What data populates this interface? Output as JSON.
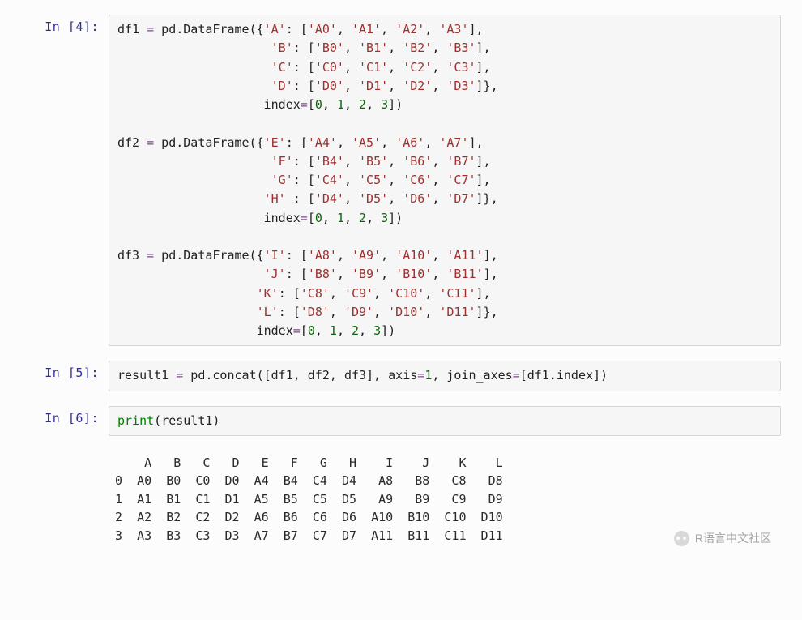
{
  "cells": [
    {
      "prompt": "In  [4]:",
      "type": "code",
      "tokens": [
        [
          "nm",
          "df1 "
        ],
        [
          "op",
          "="
        ],
        [
          "nm",
          " pd"
        ],
        [
          "p",
          "."
        ],
        [
          "nm",
          "DataFrame"
        ],
        [
          "p",
          "({"
        ],
        [
          "str",
          "'A'"
        ],
        [
          "p",
          ": ["
        ],
        [
          "str",
          "'A0'"
        ],
        [
          "p",
          ", "
        ],
        [
          "str",
          "'A1'"
        ],
        [
          "p",
          ", "
        ],
        [
          "str",
          "'A2'"
        ],
        [
          "p",
          ", "
        ],
        [
          "str",
          "'A3'"
        ],
        [
          "p",
          "],\n"
        ],
        [
          "p",
          "                     "
        ],
        [
          "str",
          "'B'"
        ],
        [
          "p",
          ": ["
        ],
        [
          "str",
          "'B0'"
        ],
        [
          "p",
          ", "
        ],
        [
          "str",
          "'B1'"
        ],
        [
          "p",
          ", "
        ],
        [
          "str",
          "'B2'"
        ],
        [
          "p",
          ", "
        ],
        [
          "str",
          "'B3'"
        ],
        [
          "p",
          "],\n"
        ],
        [
          "p",
          "                     "
        ],
        [
          "str",
          "'C'"
        ],
        [
          "p",
          ": ["
        ],
        [
          "str",
          "'C0'"
        ],
        [
          "p",
          ", "
        ],
        [
          "str",
          "'C1'"
        ],
        [
          "p",
          ", "
        ],
        [
          "str",
          "'C2'"
        ],
        [
          "p",
          ", "
        ],
        [
          "str",
          "'C3'"
        ],
        [
          "p",
          "],\n"
        ],
        [
          "p",
          "                     "
        ],
        [
          "str",
          "'D'"
        ],
        [
          "p",
          ": ["
        ],
        [
          "str",
          "'D0'"
        ],
        [
          "p",
          ", "
        ],
        [
          "str",
          "'D1'"
        ],
        [
          "p",
          ", "
        ],
        [
          "str",
          "'D2'"
        ],
        [
          "p",
          ", "
        ],
        [
          "str",
          "'D3'"
        ],
        [
          "p",
          "]},\n"
        ],
        [
          "p",
          "                    index"
        ],
        [
          "op",
          "="
        ],
        [
          "p",
          "["
        ],
        [
          "num",
          "0"
        ],
        [
          "p",
          ", "
        ],
        [
          "num",
          "1"
        ],
        [
          "p",
          ", "
        ],
        [
          "num",
          "2"
        ],
        [
          "p",
          ", "
        ],
        [
          "num",
          "3"
        ],
        [
          "p",
          "])\n"
        ],
        [
          "p",
          "\n"
        ],
        [
          "nm",
          "df2 "
        ],
        [
          "op",
          "="
        ],
        [
          "nm",
          " pd"
        ],
        [
          "p",
          "."
        ],
        [
          "nm",
          "DataFrame"
        ],
        [
          "p",
          "({"
        ],
        [
          "str",
          "'E'"
        ],
        [
          "p",
          ": ["
        ],
        [
          "str",
          "'A4'"
        ],
        [
          "p",
          ", "
        ],
        [
          "str",
          "'A5'"
        ],
        [
          "p",
          ", "
        ],
        [
          "str",
          "'A6'"
        ],
        [
          "p",
          ", "
        ],
        [
          "str",
          "'A7'"
        ],
        [
          "p",
          "],\n"
        ],
        [
          "p",
          "                     "
        ],
        [
          "str",
          "'F'"
        ],
        [
          "p",
          ": ["
        ],
        [
          "str",
          "'B4'"
        ],
        [
          "p",
          ", "
        ],
        [
          "str",
          "'B5'"
        ],
        [
          "p",
          ", "
        ],
        [
          "str",
          "'B6'"
        ],
        [
          "p",
          ", "
        ],
        [
          "str",
          "'B7'"
        ],
        [
          "p",
          "],\n"
        ],
        [
          "p",
          "                     "
        ],
        [
          "str",
          "'G'"
        ],
        [
          "p",
          ": ["
        ],
        [
          "str",
          "'C4'"
        ],
        [
          "p",
          ", "
        ],
        [
          "str",
          "'C5'"
        ],
        [
          "p",
          ", "
        ],
        [
          "str",
          "'C6'"
        ],
        [
          "p",
          ", "
        ],
        [
          "str",
          "'C7'"
        ],
        [
          "p",
          "],\n"
        ],
        [
          "p",
          "                    "
        ],
        [
          "str",
          "'H'"
        ],
        [
          "p",
          " : ["
        ],
        [
          "str",
          "'D4'"
        ],
        [
          "p",
          ", "
        ],
        [
          "str",
          "'D5'"
        ],
        [
          "p",
          ", "
        ],
        [
          "str",
          "'D6'"
        ],
        [
          "p",
          ", "
        ],
        [
          "str",
          "'D7'"
        ],
        [
          "p",
          "]},\n"
        ],
        [
          "p",
          "                    index"
        ],
        [
          "op",
          "="
        ],
        [
          "p",
          "["
        ],
        [
          "num",
          "0"
        ],
        [
          "p",
          ", "
        ],
        [
          "num",
          "1"
        ],
        [
          "p",
          ", "
        ],
        [
          "num",
          "2"
        ],
        [
          "p",
          ", "
        ],
        [
          "num",
          "3"
        ],
        [
          "p",
          "])\n"
        ],
        [
          "p",
          "\n"
        ],
        [
          "nm",
          "df3 "
        ],
        [
          "op",
          "="
        ],
        [
          "nm",
          " pd"
        ],
        [
          "p",
          "."
        ],
        [
          "nm",
          "DataFrame"
        ],
        [
          "p",
          "({"
        ],
        [
          "str",
          "'I'"
        ],
        [
          "p",
          ": ["
        ],
        [
          "str",
          "'A8'"
        ],
        [
          "p",
          ", "
        ],
        [
          "str",
          "'A9'"
        ],
        [
          "p",
          ", "
        ],
        [
          "str",
          "'A10'"
        ],
        [
          "p",
          ", "
        ],
        [
          "str",
          "'A11'"
        ],
        [
          "p",
          "],\n"
        ],
        [
          "p",
          "                    "
        ],
        [
          "str",
          "'J'"
        ],
        [
          "p",
          ": ["
        ],
        [
          "str",
          "'B8'"
        ],
        [
          "p",
          ", "
        ],
        [
          "str",
          "'B9'"
        ],
        [
          "p",
          ", "
        ],
        [
          "str",
          "'B10'"
        ],
        [
          "p",
          ", "
        ],
        [
          "str",
          "'B11'"
        ],
        [
          "p",
          "],\n"
        ],
        [
          "p",
          "                   "
        ],
        [
          "str",
          "'K'"
        ],
        [
          "p",
          ": ["
        ],
        [
          "str",
          "'C8'"
        ],
        [
          "p",
          ", "
        ],
        [
          "str",
          "'C9'"
        ],
        [
          "p",
          ", "
        ],
        [
          "str",
          "'C10'"
        ],
        [
          "p",
          ", "
        ],
        [
          "str",
          "'C11'"
        ],
        [
          "p",
          "],\n"
        ],
        [
          "p",
          "                   "
        ],
        [
          "str",
          "'L'"
        ],
        [
          "p",
          ": ["
        ],
        [
          "str",
          "'D8'"
        ],
        [
          "p",
          ", "
        ],
        [
          "str",
          "'D9'"
        ],
        [
          "p",
          ", "
        ],
        [
          "str",
          "'D10'"
        ],
        [
          "p",
          ", "
        ],
        [
          "str",
          "'D11'"
        ],
        [
          "p",
          "]},\n"
        ],
        [
          "p",
          "                   index"
        ],
        [
          "op",
          "="
        ],
        [
          "p",
          "["
        ],
        [
          "num",
          "0"
        ],
        [
          "p",
          ", "
        ],
        [
          "num",
          "1"
        ],
        [
          "p",
          ", "
        ],
        [
          "num",
          "2"
        ],
        [
          "p",
          ", "
        ],
        [
          "num",
          "3"
        ],
        [
          "p",
          "])"
        ]
      ]
    },
    {
      "prompt": "In  [5]:",
      "type": "code",
      "tokens": [
        [
          "nm",
          "result1 "
        ],
        [
          "op",
          "="
        ],
        [
          "nm",
          " pd"
        ],
        [
          "p",
          "."
        ],
        [
          "nm",
          "concat"
        ],
        [
          "p",
          "([df1, df2, df3], axis"
        ],
        [
          "op",
          "="
        ],
        [
          "num",
          "1"
        ],
        [
          "p",
          ", join_axes"
        ],
        [
          "op",
          "="
        ],
        [
          "p",
          "[df1"
        ],
        [
          "p",
          "."
        ],
        [
          "nm",
          "index"
        ],
        [
          "p",
          "])"
        ]
      ]
    },
    {
      "prompt": "In  [6]:",
      "type": "code",
      "tokens": [
        [
          "kw",
          "print"
        ],
        [
          "p",
          "("
        ],
        [
          "nm",
          "result1"
        ],
        [
          "p",
          ")"
        ]
      ]
    },
    {
      "prompt": "",
      "type": "output",
      "text": "    A   B   C   D   E   F   G   H    I    J    K    L\n0  A0  B0  C0  D0  A4  B4  C4  D4   A8   B8   C8   D8\n1  A1  B1  C1  D1  A5  B5  C5  D5   A9   B9   C9   D9\n2  A2  B2  C2  D2  A6  B6  C6  D6  A10  B10  C10  D10\n3  A3  B3  C3  D3  A7  B7  C7  D7  A11  B11  C11  D11"
    }
  ],
  "watermark": "R语言中文社区"
}
